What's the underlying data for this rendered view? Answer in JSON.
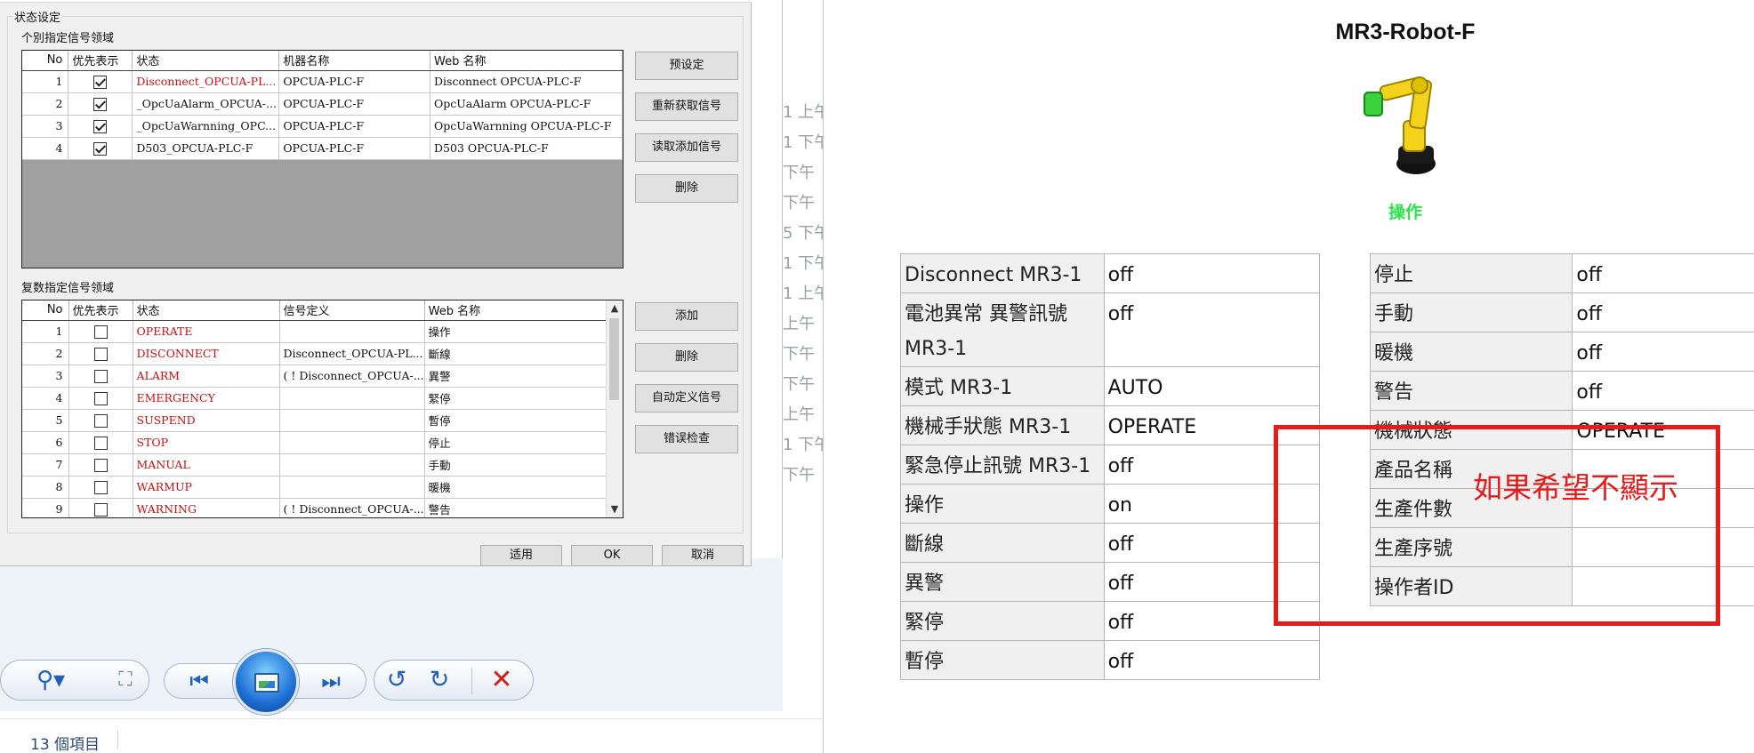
{
  "dialog": {
    "group_title": "状态设定",
    "individual_section_title": "个別指定信号领域",
    "individual_headers": [
      "No",
      "优先表示",
      "状态",
      "机器名称",
      "Web 名称"
    ],
    "individual_rows": [
      {
        "no": "1",
        "checked": true,
        "status": "Disconnect_OPCUA-PL...",
        "status_red": true,
        "device": "OPCUA-PLC-F",
        "web": "Disconnect OPCUA-PLC-F"
      },
      {
        "no": "2",
        "checked": true,
        "status": "_OpcUaAlarm_OPCUA-...",
        "status_red": false,
        "device": "OPCUA-PLC-F",
        "web": "OpcUaAlarm OPCUA-PLC-F"
      },
      {
        "no": "3",
        "checked": true,
        "status": "_OpcUaWarnning_OPC...",
        "status_red": false,
        "device": "OPCUA-PLC-F",
        "web": "OpcUaWarnning OPCUA-PLC-F"
      },
      {
        "no": "4",
        "checked": true,
        "status": "D503_OPCUA-PLC-F",
        "status_red": false,
        "device": "OPCUA-PLC-F",
        "web": "D503 OPCUA-PLC-F"
      }
    ],
    "individual_buttons": [
      "预设定",
      "重新获取信号",
      "读取添加信号",
      "删除"
    ],
    "multi_section_title": "复数指定信号领域",
    "multi_headers": [
      "No",
      "优先表示",
      "状态",
      "信号定义",
      "Web 名称"
    ],
    "multi_rows": [
      {
        "no": "1",
        "checked": false,
        "status": "OPERATE",
        "def": "",
        "web": "操作"
      },
      {
        "no": "2",
        "checked": false,
        "status": "DISCONNECT",
        "def": "Disconnect_OPCUA-PL...",
        "web": "斷線"
      },
      {
        "no": "3",
        "checked": false,
        "status": "ALARM",
        "def": "( ! Disconnect_OPCUA-...",
        "web": "異警"
      },
      {
        "no": "4",
        "checked": false,
        "status": "EMERGENCY",
        "def": "",
        "web": "緊停"
      },
      {
        "no": "5",
        "checked": false,
        "status": "SUSPEND",
        "def": "",
        "web": "暫停"
      },
      {
        "no": "6",
        "checked": false,
        "status": "STOP",
        "def": "",
        "web": "停止"
      },
      {
        "no": "7",
        "checked": false,
        "status": "MANUAL",
        "def": "",
        "web": "手動"
      },
      {
        "no": "8",
        "checked": false,
        "status": "WARMUP",
        "def": "",
        "web": "暖機"
      },
      {
        "no": "9",
        "checked": false,
        "status": "WARNING",
        "def": "( ! Disconnect_OPCUA-...",
        "web": "警告"
      }
    ],
    "multi_buttons": [
      "添加",
      "删除",
      "自动定义信号",
      "错误检查"
    ],
    "footer_buttons": {
      "apply": "适用",
      "ok": "OK",
      "cancel": "取消"
    }
  },
  "viewer": {
    "toolbar_icons": [
      "zoom-icon",
      "fit-icon",
      "previous-icon",
      "slideshow-icon",
      "next-icon",
      "rotate-left-icon",
      "rotate-right-icon",
      "delete-icon"
    ],
    "status_text": "13 個項目"
  },
  "explorer_timestamps": [
    "1 上午",
    "1 下午",
    "下午",
    "下午",
    "5 下午",
    "1 下午",
    "1 上午",
    "上午",
    "下午",
    "下午",
    "上午",
    "1 下午",
    "下午"
  ],
  "web": {
    "title": "MR3-Robot-F",
    "robot_status": "操作",
    "left_table": [
      {
        "k": "Disconnect MR3-1",
        "v": "off"
      },
      {
        "k": "電池異常 異警訊號 MR3-1",
        "v": "off"
      },
      {
        "k": "模式 MR3-1",
        "v": "AUTO"
      },
      {
        "k": "機械手狀態 MR3-1",
        "v": "OPERATE"
      },
      {
        "k": "緊急停止訊號 MR3-1",
        "v": "off"
      },
      {
        "k": "操作",
        "v": "on"
      },
      {
        "k": "斷線",
        "v": "off"
      },
      {
        "k": "異警",
        "v": "off"
      },
      {
        "k": "緊停",
        "v": "off"
      },
      {
        "k": "暫停",
        "v": "off"
      }
    ],
    "right_table": [
      {
        "k": "停止",
        "v": "off"
      },
      {
        "k": "手動",
        "v": "off"
      },
      {
        "k": "暖機",
        "v": "off"
      },
      {
        "k": "警告",
        "v": "off"
      },
      {
        "k": "機械狀態",
        "v": "OPERATE"
      },
      {
        "k": "產品名稱",
        "v": ""
      },
      {
        "k": "生產件數",
        "v": ""
      },
      {
        "k": "生產序號",
        "v": ""
      },
      {
        "k": "操作者ID",
        "v": ""
      }
    ],
    "annotation": "如果希望不顯示",
    "colors": {
      "status_green": "#2ee24a",
      "highlight_red": "#e61b1b",
      "signal_red": "#cc1010"
    }
  }
}
